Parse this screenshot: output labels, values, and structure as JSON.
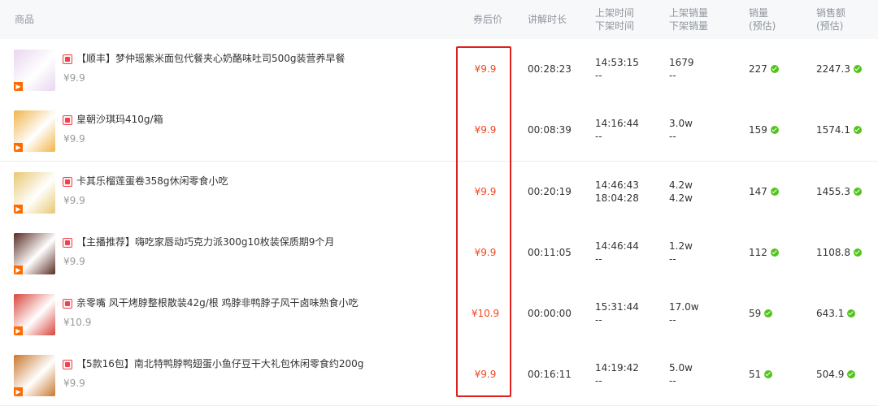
{
  "header": {
    "product": "商品",
    "coupon_price": "券后价",
    "duration": "讲解时长",
    "listed_time": "上架时间",
    "delisted_time": "下架时间",
    "listed_sales": "上架销量",
    "delisted_sales": "下架销量",
    "sales": "销量",
    "sales_est": "(预估)",
    "revenue": "销售额",
    "revenue_est": "(预估)"
  },
  "rows": [
    {
      "title": "【顺丰】梦仲瑶紫米面包代餐夹心奶酪味吐司500g装营养早餐",
      "price": "¥9.9",
      "coupon_price": "¥9.9",
      "duration": "00:28:23",
      "listed_time": "14:53:15",
      "delisted_time": "--",
      "listed_sales": "1679",
      "delisted_sales": "--",
      "sales": "227",
      "revenue": "2247.3",
      "thumb_color": "#e9d6ef"
    },
    {
      "title": "皇朝沙琪玛410g/箱",
      "price": "¥9.9",
      "coupon_price": "¥9.9",
      "duration": "00:08:39",
      "listed_time": "14:16:44",
      "delisted_time": "--",
      "listed_sales": "3.0w",
      "delisted_sales": "--",
      "sales": "159",
      "revenue": "1574.1",
      "thumb_color": "#f0b54a"
    },
    {
      "title": "卡其乐榴莲蛋卷358g休闲零食小吃",
      "price": "¥9.9",
      "coupon_price": "¥9.9",
      "duration": "00:20:19",
      "listed_time": "14:46:43",
      "delisted_time": "18:04:28",
      "listed_sales": "4.2w",
      "delisted_sales": "4.2w",
      "sales": "147",
      "revenue": "1455.3",
      "thumb_color": "#e8c770"
    },
    {
      "title": "【主播推荐】嗨吃家唇动巧克力派300g10枚装保质期9个月",
      "price": "¥9.9",
      "coupon_price": "¥9.9",
      "duration": "00:11:05",
      "listed_time": "14:46:44",
      "delisted_time": "--",
      "listed_sales": "1.2w",
      "delisted_sales": "--",
      "sales": "112",
      "revenue": "1108.8",
      "thumb_color": "#5a2b22"
    },
    {
      "title": "亲零嘴 风干烤脖整根散装42g/根 鸡脖非鸭脖子风干卤味熟食小吃",
      "price": "¥10.9",
      "coupon_price": "¥10.9",
      "duration": "00:00:00",
      "listed_time": "15:31:44",
      "delisted_time": "--",
      "listed_sales": "17.0w",
      "delisted_sales": "--",
      "sales": "59",
      "revenue": "643.1",
      "thumb_color": "#d9443a"
    },
    {
      "title": "【5款16包】南北特鸭脖鸭翅蛋小鱼仔豆干大礼包休闲零食约200g",
      "price": "¥9.9",
      "coupon_price": "¥9.9",
      "duration": "00:16:11",
      "listed_time": "14:19:42",
      "delisted_time": "--",
      "listed_sales": "5.0w",
      "delisted_sales": "--",
      "sales": "51",
      "revenue": "504.9",
      "thumb_color": "#c9772e"
    }
  ]
}
